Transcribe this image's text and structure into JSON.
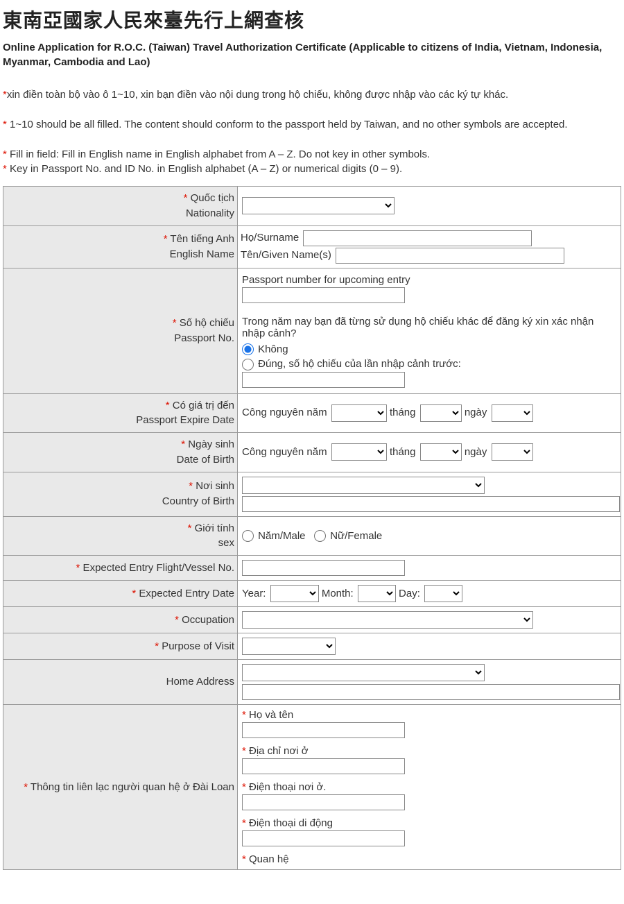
{
  "header": {
    "title_zh": "東南亞國家人民來臺先行上網查核",
    "subtitle_en": "Online Application for R.O.C. (Taiwan) Travel Authorization Certificate (Applicable to citizens of India, Vietnam, Indonesia, Myanmar, Cambodia and Lao)"
  },
  "instructions": {
    "line1": "xin điền toàn bộ vào ô 1~10, xin bạn điền vào nội dung trong hộ chiếu, không được nhập vào các ký tự khác.",
    "line2": " 1~10 should be all filled. The content should conform to the passport held by Taiwan, and no other symbols are accepted.",
    "line3": " Fill in field: Fill in English name in English alphabet from A – Z. Do not key in other symbols.",
    "line4": " Key in Passport No. and ID No. in English alphabet (A – Z) or numerical digits (0 – 9)."
  },
  "labels": {
    "nationality_vi": " Quốc tịch",
    "nationality_en": "Nationality",
    "english_name_vi": " Tên tiếng Anh",
    "english_name_en": "English Name",
    "surname": "Họ/Surname",
    "given": "Tên/Given Name(s)",
    "passport_vi": " Số hộ chiếu",
    "passport_en": "Passport No.",
    "passport_upcoming": "Passport number for upcoming entry",
    "passport_question": "Trong năm nay bạn đã từng sử dụng hộ chiếu khác để đăng ký xin xác nhận nhập cảnh?",
    "radio_no": "Không",
    "radio_yes": "Đúng, số hộ chiếu của lần nhập cảnh trước:",
    "expire_vi": " Có giá trị đến",
    "expire_en": "Passport Expire Date",
    "dob_vi": " Ngày sinh",
    "dob_en": "Date of Birth",
    "date_prefix": "Công nguyên năm",
    "month": "tháng",
    "day": "ngày",
    "cob_vi": " Nơi sinh",
    "cob_en": "Country of Birth",
    "sex_vi": " Giới tính",
    "sex_en": "sex",
    "male": "Năm/Male",
    "female": "Nữ/Female",
    "flight": " Expected Entry Flight/Vessel No.",
    "entry_date": " Expected Entry Date",
    "entry_year": "Year:",
    "entry_month": "Month:",
    "entry_day": "Day:",
    "occupation": " Occupation",
    "purpose": " Purpose of Visit",
    "home_address": "Home Address",
    "contact_tw": " Thông tin liên lạc người quan hệ ở Đài Loan",
    "ct_name": " Họ và tên",
    "ct_addr": " Địa chỉ nơi ở",
    "ct_tel_home": " Điện thoại nơi ở.",
    "ct_tel_mobile": " Điện thoại di động",
    "ct_relation": " Quan hệ"
  }
}
